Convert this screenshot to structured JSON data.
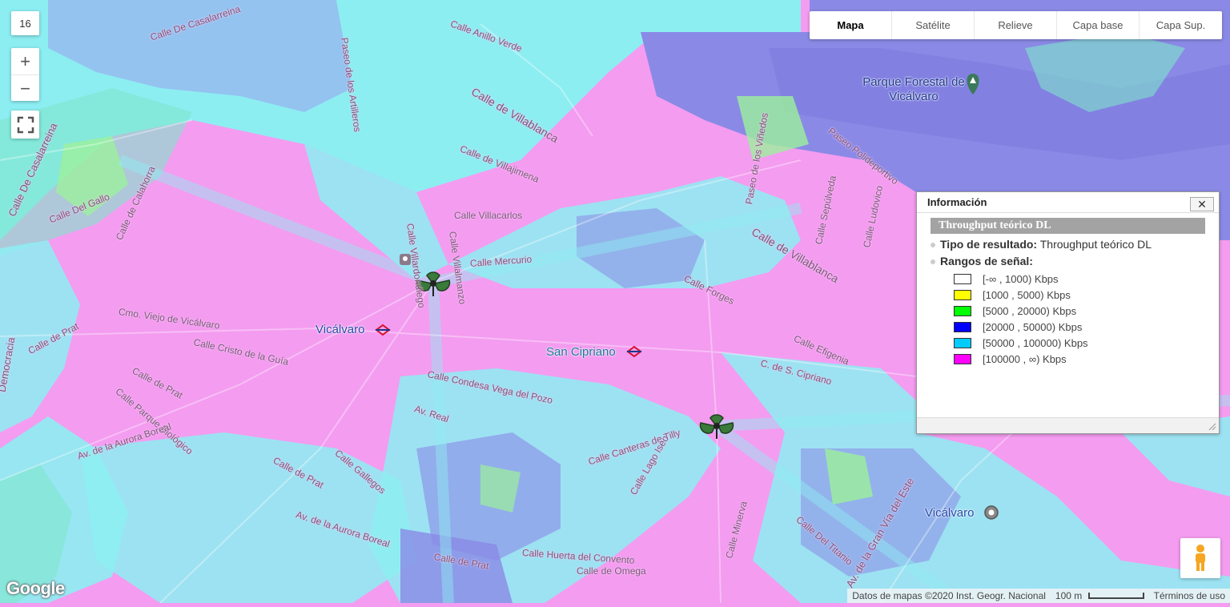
{
  "map": {
    "zoom": "16",
    "zoom_in": "+",
    "zoom_out": "−",
    "streets": [
      "Calle De Casalarreina",
      "Calle Anillo Verde",
      "Paseo de los Artilleros",
      "Calle de Villablanca",
      "Calle De Casalarreina",
      "Calle de Villajimena",
      "Calle Villacarlos",
      "Calle Villardondiego",
      "Calle Villalmanzo",
      "Calle Mercurio",
      "Cmo. Viejo de Vicálvaro",
      "Calle Cristo de la Guía",
      "Calle de Prat",
      "Calle de Prat",
      "Calle Parque Biológico",
      "Av. de la Aurora Boreal",
      "Calle Condesa Vega del Pozo",
      "Av. Real",
      "Calle Gallegos",
      "Calle de Prat",
      "Av. de la Aurora Boreal",
      "Calle de Prat",
      "Calle Huerta del Convento",
      "Calle de Omega",
      "Calle Canteras de Tilly",
      "Calle Lago Iseo",
      "Calle Minerva",
      "Calle Efigenia",
      "C. de S. Cipriano",
      "Calle Forges",
      "Calle de Villablanca",
      "Calle Del Titanio",
      "Av. de la Gran Vía del Este",
      "Paseo Polideportivo",
      "Paseo de los Viñedos",
      "Calle Del Gallo",
      "Calle de Calahorra",
      "Democracia",
      "Calle Sepúlveda",
      "Calle Ludovico"
    ],
    "pois": {
      "parque": "Parque Forestal de Vicálvaro",
      "metro_vicalvaro": "Vicálvaro",
      "metro_san_cipriano": "San Cipriano",
      "rail_vicalvaro": "Vicálvaro"
    }
  },
  "map_types": [
    "Mapa",
    "Satélite",
    "Relieve",
    "Capa base",
    "Capa Sup."
  ],
  "info": {
    "title": "Información",
    "close": "✕",
    "banner": "Throughput teórico DL",
    "result_label": "Tipo de resultado:",
    "result_value": " Throughput teórico DL",
    "ranges_label": "Rangos de señal:",
    "legend": [
      {
        "label": "[-∞ , 1000) Kbps",
        "color": "#ffffff"
      },
      {
        "label": "[1000 , 5000) Kbps",
        "color": "#ffff00"
      },
      {
        "label": "[5000 , 20000) Kbps",
        "color": "#00ff00"
      },
      {
        "label": "[20000 , 50000) Kbps",
        "color": "#0000ff"
      },
      {
        "label": "[50000 , 100000) Kbps",
        "color": "#00ccff"
      },
      {
        "label": "[100000 , ∞) Kbps",
        "color": "#ff00ff"
      }
    ]
  },
  "attribution": {
    "data": "Datos de mapas ©2020 Inst. Geogr. Nacional",
    "scale": "100 m",
    "terms": "Términos de uso"
  },
  "google": "Google",
  "colors": {
    "coverage_magenta": "#f49cf0",
    "coverage_cyan": "#8deef2",
    "coverage_blue": "#8a8ae6",
    "coverage_green": "#9cf09c",
    "coverage_teal": "#7fe6cc"
  }
}
